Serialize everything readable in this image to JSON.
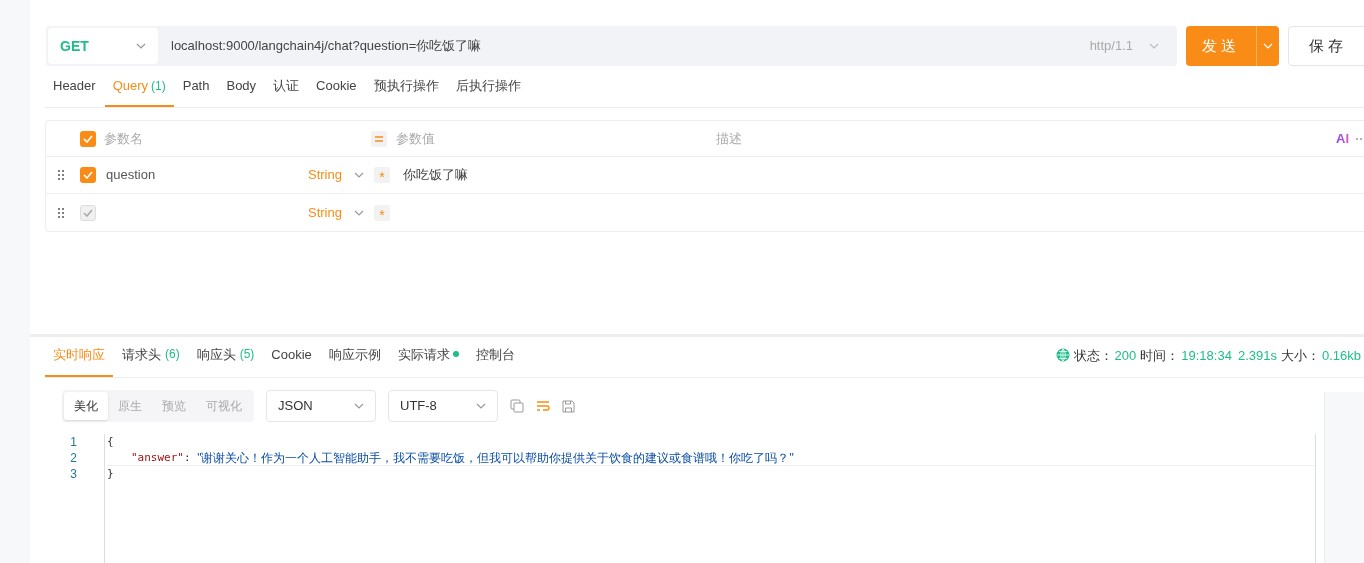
{
  "request": {
    "method": "GET",
    "url": "localhost:9000/langchain4j/chat?question=你吃饭了嘛",
    "protocol": "http/1.1",
    "send": "发送",
    "save": "保存"
  },
  "request_tabs": [
    {
      "label": "Header",
      "selected": false
    },
    {
      "label": "Query",
      "count": "(1)",
      "selected": true
    },
    {
      "label": "Path",
      "selected": false
    },
    {
      "label": "Body",
      "selected": false
    },
    {
      "label": "认证",
      "selected": false
    },
    {
      "label": "Cookie",
      "selected": false
    },
    {
      "label": "预执行操作",
      "selected": false
    },
    {
      "label": "后执行操作",
      "selected": false
    }
  ],
  "params": {
    "header": {
      "checked": true,
      "name": "参数名",
      "value": "参数值",
      "description": "描述",
      "ai": "AI"
    },
    "rows": [
      {
        "checked": true,
        "disabled": false,
        "name": "question",
        "type": "String",
        "required": "*",
        "value": "你吃饭了嘛"
      },
      {
        "checked": true,
        "disabled": true,
        "type": "String",
        "required": "*"
      }
    ]
  },
  "response_tabs": [
    {
      "label": "实时响应",
      "selected": true
    },
    {
      "label": "请求头",
      "count": "(6)",
      "selected": false
    },
    {
      "label": "响应头",
      "count": "(5)",
      "selected": false
    },
    {
      "label": "Cookie",
      "selected": false
    },
    {
      "label": "响应示例",
      "selected": false
    },
    {
      "label": "实际请求",
      "dot": true,
      "selected": false
    },
    {
      "label": "控制台",
      "selected": false
    }
  ],
  "status": {
    "status_label": "状态：",
    "status": "200",
    "time_label": "时间：",
    "time": "19:18:34",
    "duration": "2.391s",
    "size_label": "大小：",
    "size": "0.16kb"
  },
  "view_modes": [
    {
      "label": "美化",
      "selected": true
    },
    {
      "label": "原生",
      "selected": false
    },
    {
      "label": "预览",
      "selected": false
    },
    {
      "label": "可视化",
      "selected": false
    }
  ],
  "format": "JSON",
  "encoding": "UTF-8",
  "code_lines": [
    {
      "number": "1",
      "tokens": [
        {
          "kind": "punct",
          "text": "{"
        }
      ]
    },
    {
      "number": "2",
      "tokens": [
        {
          "kind": "key",
          "text": "\"answer\""
        },
        {
          "kind": "punct",
          "text": ": "
        },
        {
          "kind": "string",
          "text": "\"谢谢关心！作为一个人工智能助手，我不需要吃饭，但我可以帮助你提供关于饮食的建议或食谱哦！你吃了吗？\""
        }
      ]
    },
    {
      "number": "3",
      "tokens": [
        {
          "kind": "punct",
          "text": "}"
        }
      ]
    }
  ]
}
